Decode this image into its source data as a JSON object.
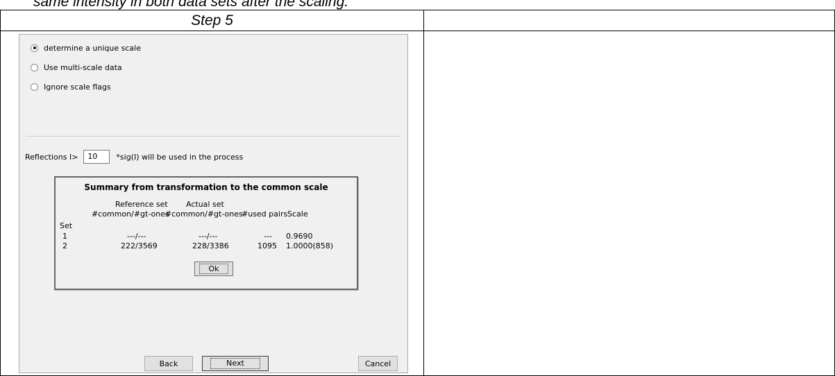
{
  "top_caption": "same intensity in both data sets after the scaling.",
  "step_title": "Step 5",
  "dialog": {
    "radio_options": [
      {
        "label": "determine a unique scale",
        "selected": true
      },
      {
        "label": "Use multi-scale data",
        "selected": false
      },
      {
        "label": "Ignore scale flags",
        "selected": false
      }
    ],
    "reflections_label": "Reflections I>",
    "reflections_value": "10",
    "reflections_suffix": "*sig(I) will be used in the process",
    "summary": {
      "title": "Summary from transformation to the common scale",
      "headers": {
        "set": "Set",
        "ref_line1": "Reference set",
        "ref_line2": "#common/#gt-ones",
        "act_line1": "Actual set",
        "act_line2": "#common/#gt-ones",
        "pairs": "#used pairs",
        "scale": "Scale"
      },
      "rows": [
        {
          "set": "1",
          "ref": "---/---",
          "act": "---/---",
          "pairs": "---",
          "scale": "0.9690"
        },
        {
          "set": "2",
          "ref": "222/3569",
          "act": "228/3386",
          "pairs": "1095",
          "scale": "1.0000(858)"
        }
      ],
      "ok_label": "Ok"
    },
    "buttons": {
      "back": "Back",
      "next": "Next",
      "cancel": "Cancel"
    }
  }
}
